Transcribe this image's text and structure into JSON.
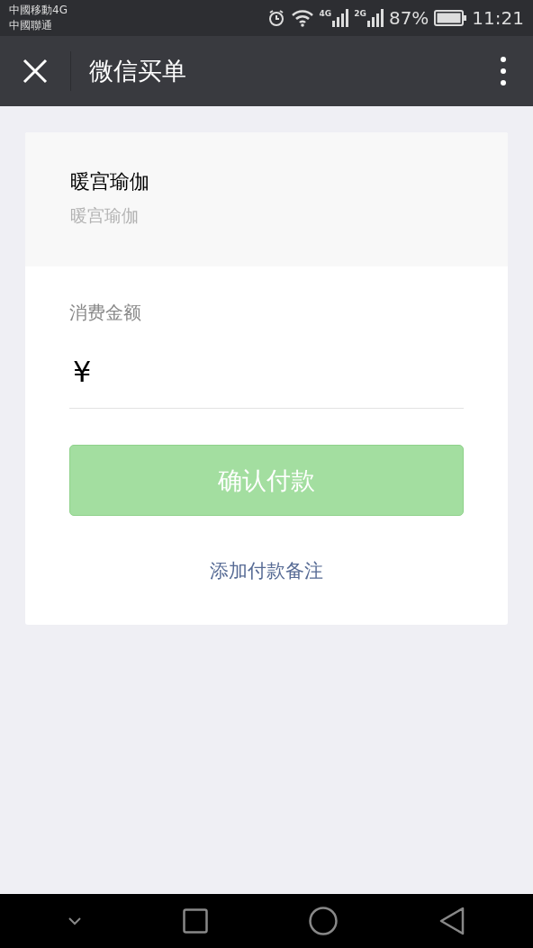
{
  "status_bar": {
    "carriers": [
      "中國移動4G",
      "中國聯通"
    ],
    "signals": [
      "4G",
      "2G"
    ],
    "battery": "87%",
    "time": "11:21"
  },
  "nav": {
    "title": "微信买单"
  },
  "merchant": {
    "name": "暖宫瑜伽",
    "subtitle": "暖宫瑜伽"
  },
  "amount": {
    "label": "消费金额",
    "currency": "¥"
  },
  "pay_button": {
    "label": "确认付款",
    "disabled": true
  },
  "note_link": "添加付款备注"
}
